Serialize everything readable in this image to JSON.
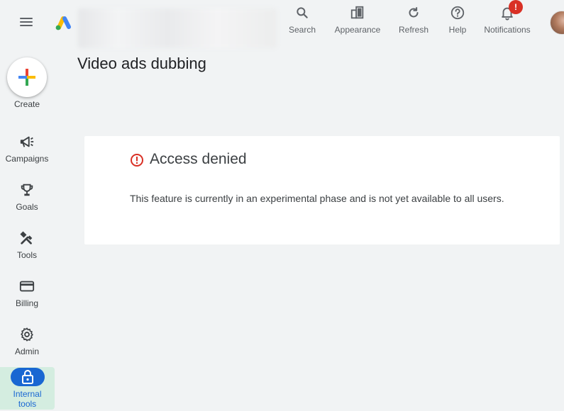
{
  "header": {
    "actions": [
      {
        "label": "Search",
        "icon": "search-icon"
      },
      {
        "label": "Appearance",
        "icon": "appearance-icon"
      },
      {
        "label": "Refresh",
        "icon": "refresh-icon"
      },
      {
        "label": "Help",
        "icon": "help-icon"
      },
      {
        "label": "Notifications",
        "icon": "bell-icon",
        "badge": "!"
      }
    ]
  },
  "page": {
    "title": "Video ads dubbing"
  },
  "sidebar": {
    "create_label": "Create",
    "items": [
      {
        "label": "Campaigns",
        "icon": "megaphone-icon"
      },
      {
        "label": "Goals",
        "icon": "trophy-icon"
      },
      {
        "label": "Tools",
        "icon": "tools-icon"
      },
      {
        "label": "Billing",
        "icon": "credit-card-icon"
      },
      {
        "label": "Admin",
        "icon": "gear-icon"
      },
      {
        "label": "Internal tools",
        "icon": "lock-icon"
      }
    ]
  },
  "card": {
    "title": "Access denied",
    "message": "This feature is currently in an experimental phase and is not yet available to all users."
  },
  "colors": {
    "background": "#f1f3f4",
    "card": "#ffffff",
    "error": "#d93025",
    "accent": "#1967d2",
    "active_nav": "#d4ede0"
  }
}
